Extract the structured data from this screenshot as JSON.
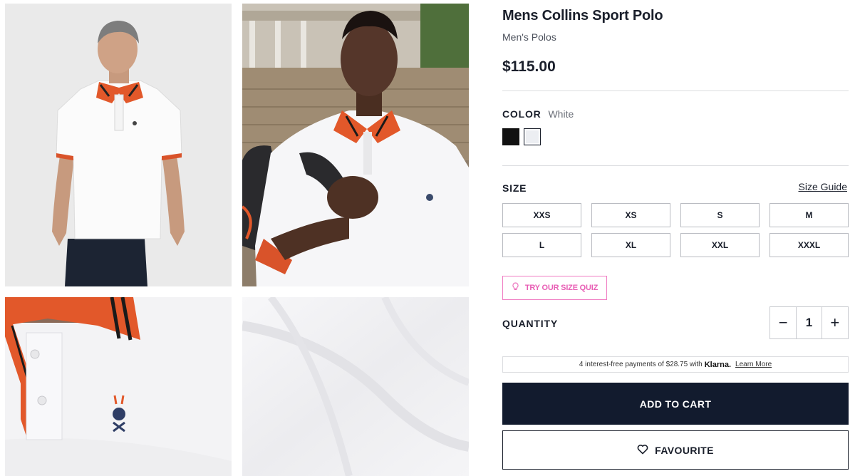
{
  "gallery": {
    "images": [
      {
        "name": "photo-model-front",
        "alt": "Model in white polo, front view"
      },
      {
        "name": "photo-model-lifestyle",
        "alt": "Model in white polo outdoors"
      },
      {
        "name": "photo-collar-detail",
        "alt": "Collar and logo detail"
      },
      {
        "name": "photo-fabric-detail",
        "alt": "Fabric texture detail"
      }
    ]
  },
  "product": {
    "title": "Mens Collins Sport Polo",
    "category": "Men's Polos",
    "price": "$115.00"
  },
  "color": {
    "label": "COLOR",
    "selected": "White",
    "swatches": [
      {
        "name": "Black",
        "hex": "#111111"
      },
      {
        "name": "White",
        "hex": "#eceef2"
      }
    ]
  },
  "size": {
    "label": "SIZE",
    "guide_label": "Size Guide",
    "options": [
      "XXS",
      "XS",
      "S",
      "M",
      "L",
      "XL",
      "XXL",
      "XXXL"
    ]
  },
  "quiz": {
    "label": "TRY OUR SIZE QUIZ",
    "icon": "lightbulb-icon"
  },
  "quantity": {
    "label": "QUANTITY",
    "value": "1",
    "minus": "−",
    "plus": "+"
  },
  "klarna": {
    "text": "4 interest-free payments of $28.75 with",
    "brand": "Klarna.",
    "link": "Learn More"
  },
  "actions": {
    "add_to_cart": "ADD TO CART",
    "favourite": "FAVOURITE",
    "favourite_icon": "heart-icon"
  },
  "colors": {
    "primary_dark": "#121b2e",
    "accent_pink": "#e85fb5",
    "collar_orange": "#e2582a"
  }
}
